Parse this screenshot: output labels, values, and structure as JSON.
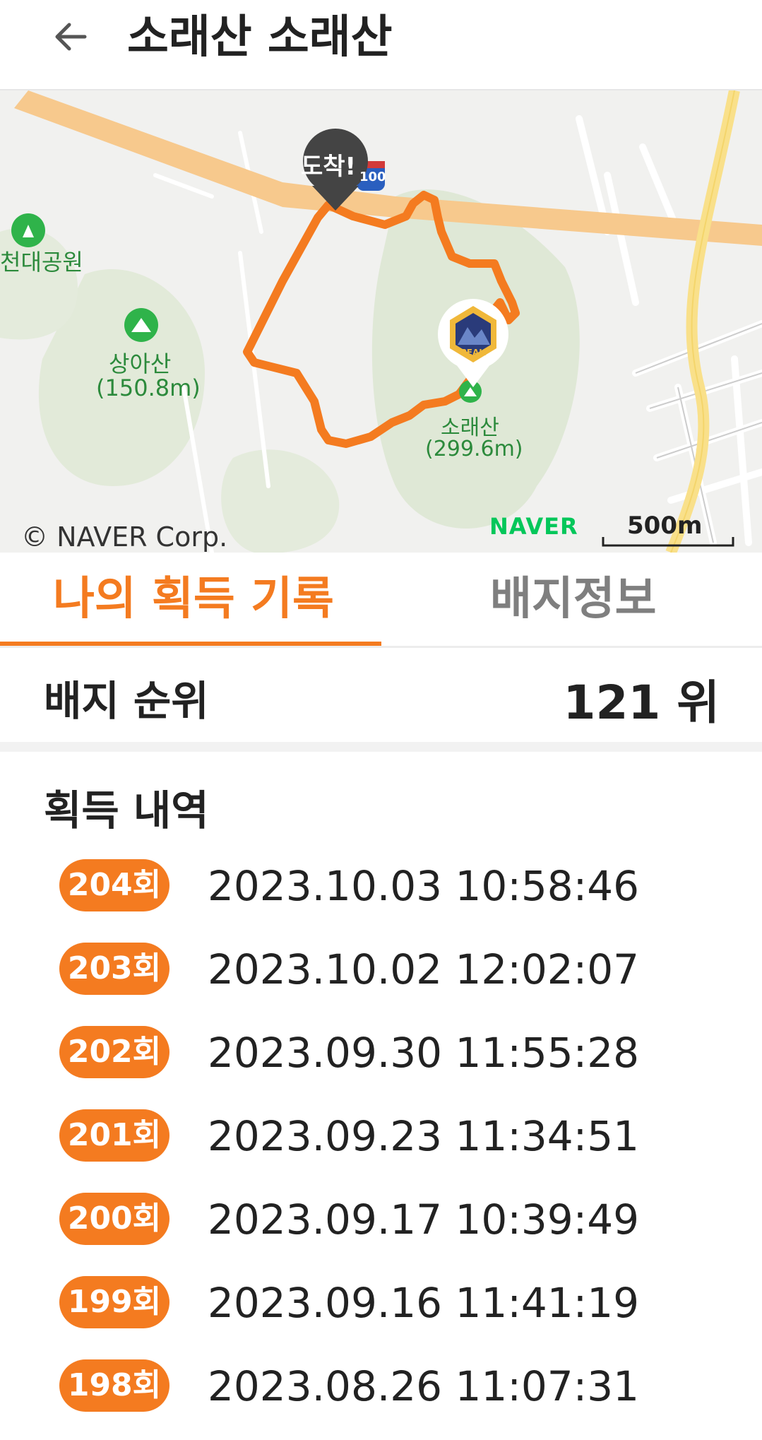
{
  "header": {
    "title": "소래산 소래산",
    "back_icon": "back-arrow-icon"
  },
  "map": {
    "labels": {
      "park": "천대공원",
      "mountain1_name": "상아산",
      "mountain1_height": "(150.8m)",
      "mountain2_name": "소래산",
      "mountain2_height": "(299.6m)",
      "arrival": "도착!",
      "highway_shield": "100"
    },
    "copyright": "© NAVER Corp.",
    "brand": "NAVER",
    "scale": "500m",
    "route_color": "#f47b20",
    "badge_text": "PEAK"
  },
  "tabs": [
    {
      "label": "나의 획득 기록",
      "active": true
    },
    {
      "label": "배지정보",
      "active": false
    }
  ],
  "rank": {
    "label": "배지 순위",
    "value": "121 위"
  },
  "history": {
    "title": "획득 내역",
    "items": [
      {
        "count": "204회",
        "datetime": "2023.10.03 10:58:46"
      },
      {
        "count": "203회",
        "datetime": "2023.10.02 12:02:07"
      },
      {
        "count": "202회",
        "datetime": "2023.09.30 11:55:28"
      },
      {
        "count": "201회",
        "datetime": "2023.09.23 11:34:51"
      },
      {
        "count": "200회",
        "datetime": "2023.09.17 10:39:49"
      },
      {
        "count": "199회",
        "datetime": "2023.09.16 11:41:19"
      },
      {
        "count": "198회",
        "datetime": "2023.08.26 11:07:31"
      }
    ]
  },
  "colors": {
    "accent": "#f47b20",
    "naver_green": "#03c75a"
  }
}
